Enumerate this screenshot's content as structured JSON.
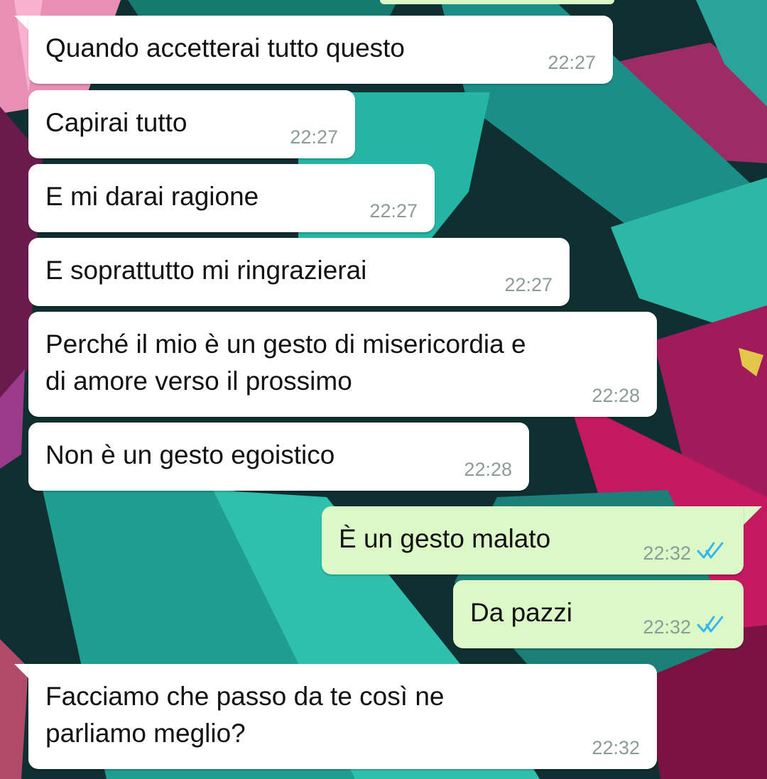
{
  "messages": [
    {
      "direction": "in",
      "text": "Quando accetterai tutto questo",
      "time": "22:27"
    },
    {
      "direction": "in",
      "text": "Capirai tutto",
      "time": "22:27"
    },
    {
      "direction": "in",
      "text": "E mi darai ragione",
      "time": "22:27"
    },
    {
      "direction": "in",
      "text": "E soprattutto mi ringrazierai",
      "time": "22:27"
    },
    {
      "direction": "in",
      "text": "Perché il mio è un gesto di misericordia e\ndi amore verso il prossimo",
      "time": "22:28"
    },
    {
      "direction": "in",
      "text": "Non è un gesto egoistico",
      "time": "22:28"
    },
    {
      "direction": "out",
      "text": "È un gesto malato",
      "time": "22:32",
      "status": "read-double-check-icon"
    },
    {
      "direction": "out",
      "text": "Da pazzi",
      "time": "22:32",
      "status": "read-double-check-icon"
    },
    {
      "direction": "in",
      "text": "Facciamo che passo da te così ne\nparliamo meglio?",
      "time": "22:32"
    }
  ],
  "colors": {
    "incoming_bubble": "#ffffff",
    "outgoing_bubble": "#dcf8c6",
    "timestamp": "#8c9a9a",
    "read_ticks": "#34b7f1"
  }
}
